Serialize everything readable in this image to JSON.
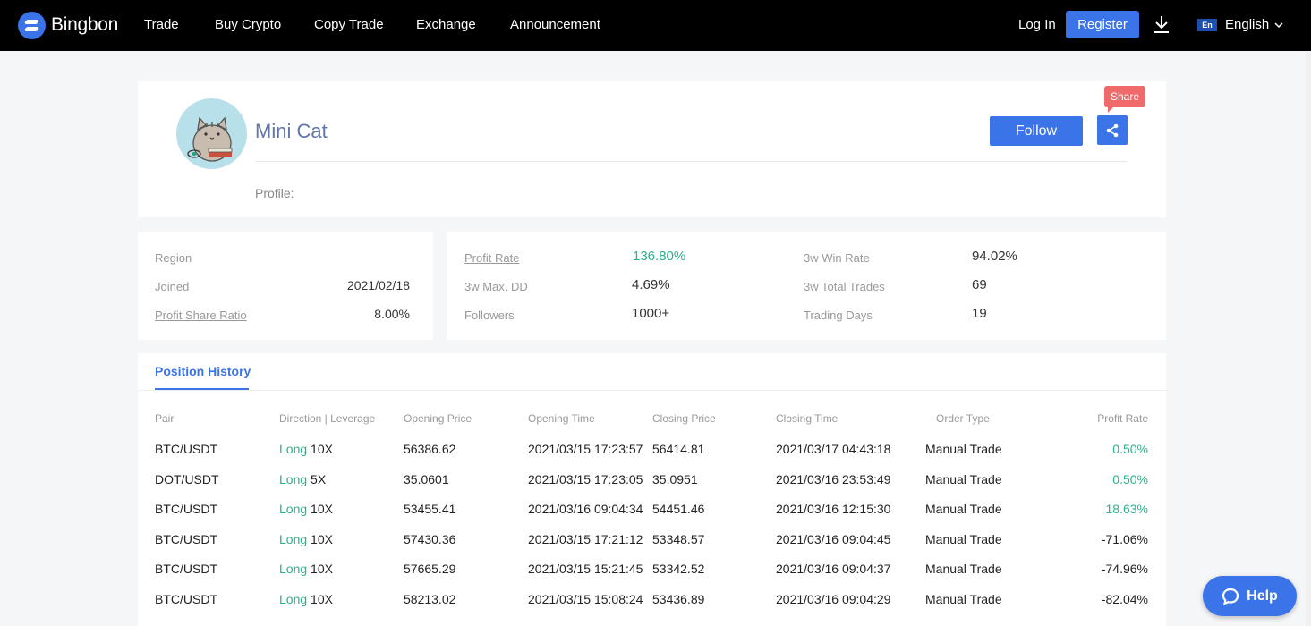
{
  "nav": {
    "logo_text": "Bingbon",
    "items": [
      "Trade",
      "Buy Crypto",
      "Copy Trade",
      "Exchange",
      "Announcement"
    ],
    "login_label": "Log In",
    "register_label": "Register",
    "lang_code": "En",
    "lang_label": "English"
  },
  "profile": {
    "name": "Mini Cat",
    "profile_label": "Profile:",
    "follow_label": "Follow",
    "share_tooltip": "Share"
  },
  "region_card": {
    "region_label": "Region",
    "region_value": "",
    "joined_label": "Joined",
    "joined_value": "2021/02/18",
    "profit_share_label": "Profit Share Ratio",
    "profit_share_value": "8.00%"
  },
  "stats": {
    "profit_rate_label": "Profit Rate",
    "profit_rate_value": "136.80%",
    "max_dd_label": "3w Max. DD",
    "max_dd_value": "4.69%",
    "followers_label": "Followers",
    "followers_value": "1000+",
    "win_rate_label": "3w Win Rate",
    "win_rate_value": "94.02%",
    "total_trades_label": "3w Total Trades",
    "total_trades_value": "69",
    "trading_days_label": "Trading Days",
    "trading_days_value": "19"
  },
  "history": {
    "tab_label": "Position History",
    "columns": [
      "Pair",
      "Direction | Leverage",
      "Opening Price",
      "Opening Time",
      "Closing Price",
      "Closing Time",
      "Order Type",
      "Profit Rate"
    ],
    "rows": [
      {
        "pair": "BTC/USDT",
        "direction": "Long",
        "leverage": "10X",
        "open_price": "56386.62",
        "open_time": "2021/03/15 17:23:57",
        "close_price": "56414.81",
        "close_time": "2021/03/17 04:43:18",
        "order_type": "Manual Trade",
        "profit": "0.50%",
        "positive": true
      },
      {
        "pair": "DOT/USDT",
        "direction": "Long",
        "leverage": "5X",
        "open_price": "35.0601",
        "open_time": "2021/03/15 17:23:05",
        "close_price": "35.0951",
        "close_time": "2021/03/16 23:53:49",
        "order_type": "Manual Trade",
        "profit": "0.50%",
        "positive": true
      },
      {
        "pair": "BTC/USDT",
        "direction": "Long",
        "leverage": "10X",
        "open_price": "53455.41",
        "open_time": "2021/03/16 09:04:34",
        "close_price": "54451.46",
        "close_time": "2021/03/16 12:15:30",
        "order_type": "Manual Trade",
        "profit": "18.63%",
        "positive": true
      },
      {
        "pair": "BTC/USDT",
        "direction": "Long",
        "leverage": "10X",
        "open_price": "57430.36",
        "open_time": "2021/03/15 17:21:12",
        "close_price": "53348.57",
        "close_time": "2021/03/16 09:04:45",
        "order_type": "Manual Trade",
        "profit": "-71.06%",
        "positive": false
      },
      {
        "pair": "BTC/USDT",
        "direction": "Long",
        "leverage": "10X",
        "open_price": "57665.29",
        "open_time": "2021/03/15 15:21:45",
        "close_price": "53342.52",
        "close_time": "2021/03/16 09:04:37",
        "order_type": "Manual Trade",
        "profit": "-74.96%",
        "positive": false
      },
      {
        "pair": "BTC/USDT",
        "direction": "Long",
        "leverage": "10X",
        "open_price": "58213.02",
        "open_time": "2021/03/15 15:08:24",
        "close_price": "53436.89",
        "close_time": "2021/03/16 09:04:29",
        "order_type": "Manual Trade",
        "profit": "-82.04%",
        "positive": false
      }
    ]
  },
  "help": {
    "label": "Help"
  },
  "colors": {
    "accent": "#3b73e8",
    "positive": "#2bb28a",
    "share_tooltip": "#f06a6a",
    "topbar": "#000000"
  },
  "icons": [
    "bingbon-logo-icon",
    "download-icon",
    "chevron-down-icon",
    "share-icon",
    "chat-icon",
    "cat-avatar"
  ]
}
